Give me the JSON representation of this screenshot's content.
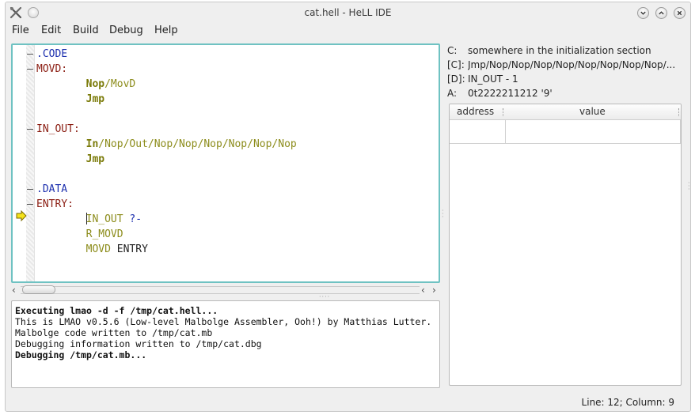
{
  "window": {
    "title": "cat.hell - HeLL IDE"
  },
  "menu": {
    "items": [
      "File",
      "Edit",
      "Build",
      "Debug",
      "Help"
    ]
  },
  "editor": {
    "lines": [
      {
        "fold": true,
        "parts": [
          {
            "t": ".CODE",
            "c": "kw-directive"
          }
        ]
      },
      {
        "fold": true,
        "parts": [
          {
            "t": "MOVD:",
            "c": "kw-label"
          }
        ]
      },
      {
        "fold": false,
        "parts": [
          {
            "t": "        ",
            "c": "kw-plain"
          },
          {
            "t": "Nop",
            "c": "kw-instr"
          },
          {
            "t": "/MovD",
            "c": "kw-instr-dim"
          }
        ]
      },
      {
        "fold": false,
        "parts": [
          {
            "t": "        ",
            "c": "kw-plain"
          },
          {
            "t": "Jmp",
            "c": "kw-instr"
          }
        ]
      },
      {
        "fold": false,
        "parts": []
      },
      {
        "fold": true,
        "parts": [
          {
            "t": "IN_OUT:",
            "c": "kw-label"
          }
        ]
      },
      {
        "fold": false,
        "parts": [
          {
            "t": "        ",
            "c": "kw-plain"
          },
          {
            "t": "In",
            "c": "kw-instr"
          },
          {
            "t": "/Nop/Out/Nop/Nop/Nop/Nop/Nop/Nop",
            "c": "kw-instr-dim"
          }
        ]
      },
      {
        "fold": false,
        "parts": [
          {
            "t": "        ",
            "c": "kw-plain"
          },
          {
            "t": "Jmp",
            "c": "kw-instr"
          }
        ]
      },
      {
        "fold": false,
        "parts": []
      },
      {
        "fold": true,
        "parts": [
          {
            "t": ".DATA",
            "c": "kw-directive"
          }
        ]
      },
      {
        "fold": true,
        "parts": [
          {
            "t": "ENTRY:",
            "c": "kw-label"
          }
        ]
      },
      {
        "fold": false,
        "caret": true,
        "parts": [
          {
            "t": "        ",
            "c": "kw-plain"
          },
          {
            "t": "IN_OUT",
            "c": "kw-instr-dim"
          },
          {
            "t": " ?-",
            "c": "kw-operator"
          }
        ]
      },
      {
        "fold": false,
        "parts": [
          {
            "t": "        ",
            "c": "kw-plain"
          },
          {
            "t": "R_MOVD",
            "c": "kw-instr-dim"
          }
        ]
      },
      {
        "fold": false,
        "parts": [
          {
            "t": "        ",
            "c": "kw-plain"
          },
          {
            "t": "MOVD",
            "c": "kw-instr-dim"
          },
          {
            "t": " ENTRY",
            "c": "kw-plain"
          }
        ]
      }
    ],
    "breakpoint_line": 12
  },
  "console": {
    "lines": [
      {
        "text": "Executing lmao -d -f /tmp/cat.hell...",
        "bold": true
      },
      {
        "text": "This is LMAO v0.5.6 (Low-level Malbolge Assembler, Ooh!) by Matthias Lutter.",
        "bold": false
      },
      {
        "text": "Malbolge code written to /tmp/cat.mb",
        "bold": false
      },
      {
        "text": "Debugging information written to /tmp/cat.dbg",
        "bold": false
      },
      {
        "text": "Debugging /tmp/cat.mb...",
        "bold": true
      }
    ]
  },
  "registers": [
    {
      "name": "C:",
      "value": "somewhere in the initialization section"
    },
    {
      "name": "[C]:",
      "value": "Jmp/Nop/Nop/Nop/Nop/Nop/Nop/Nop/Nop/..."
    },
    {
      "name": "[D]:",
      "value": "IN_OUT - 1"
    },
    {
      "name": "A:",
      "value": "0t2222211212 '9'"
    }
  ],
  "memory": {
    "columns": [
      "address",
      "value"
    ]
  },
  "status": {
    "position": "Line: 12; Column: 9"
  }
}
